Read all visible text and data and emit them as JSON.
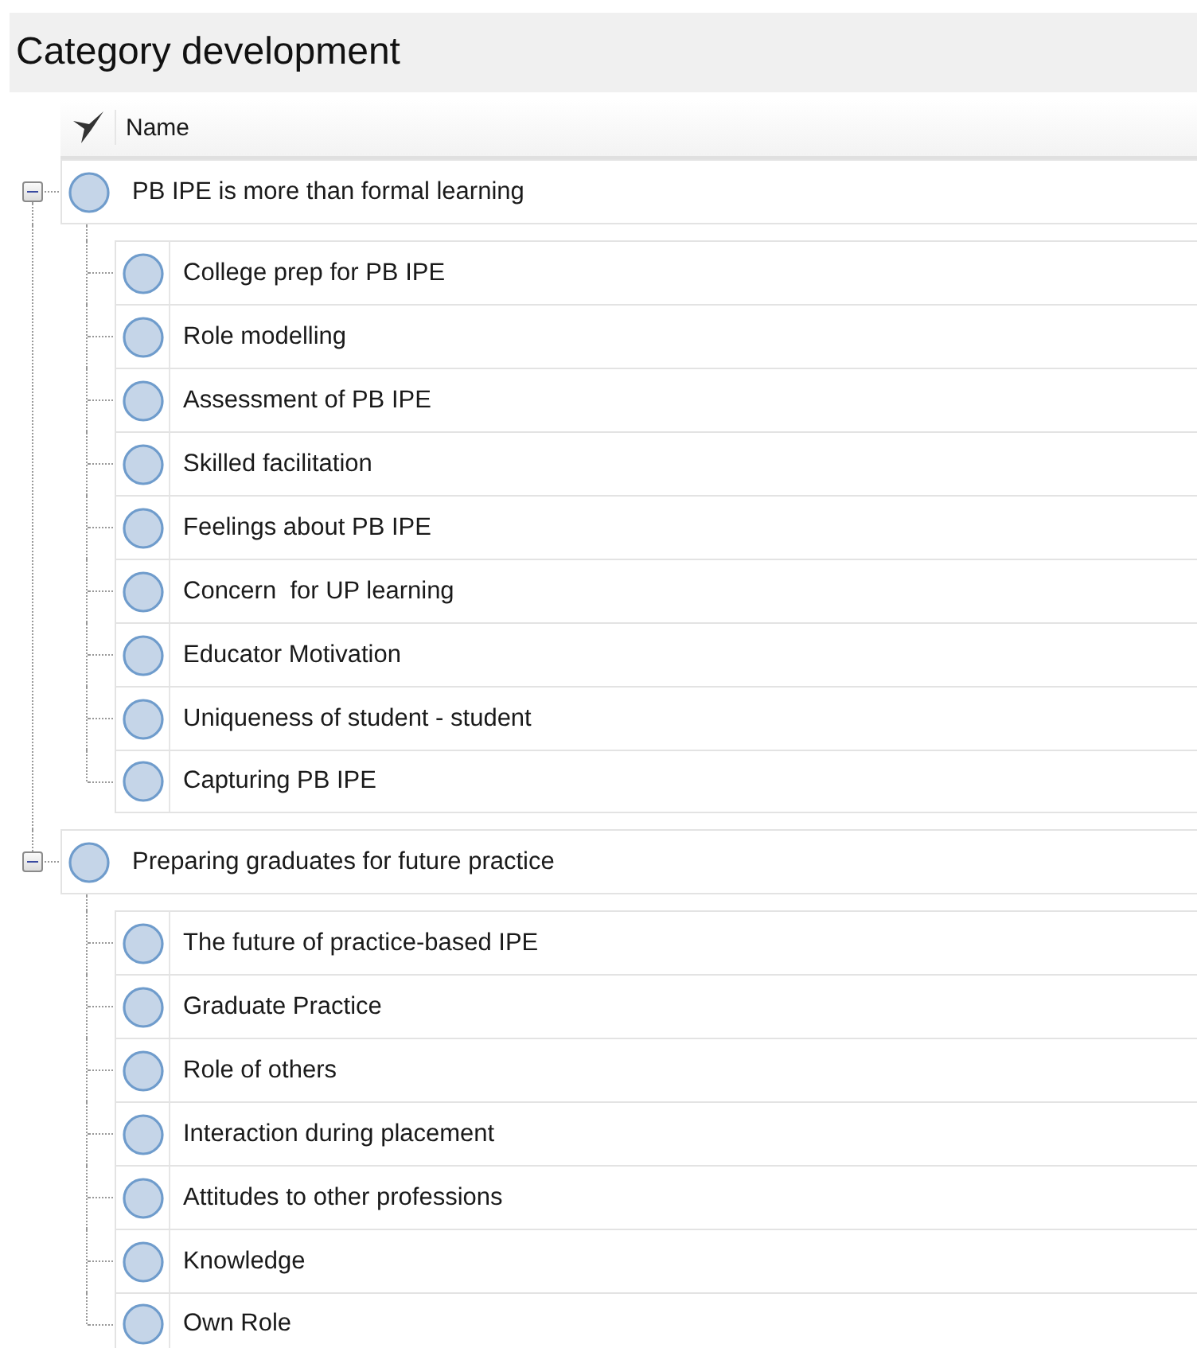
{
  "title": "Category development",
  "column_header": "Name",
  "categories": [
    {
      "name": "PB IPE is more than formal learning",
      "expanded": true,
      "children": [
        {
          "name": "College prep for PB IPE"
        },
        {
          "name": "Role modelling"
        },
        {
          "name": "Assessment of PB IPE"
        },
        {
          "name": "Skilled facilitation"
        },
        {
          "name": "Feelings about PB IPE"
        },
        {
          "name": "Concern  for UP learning"
        },
        {
          "name": "Educator Motivation"
        },
        {
          "name": "Uniqueness of student - student"
        },
        {
          "name": "Capturing PB IPE"
        }
      ]
    },
    {
      "name": "Preparing graduates for future practice",
      "expanded": true,
      "children": [
        {
          "name": "The future of practice-based IPE"
        },
        {
          "name": "Graduate Practice"
        },
        {
          "name": "Role of others"
        },
        {
          "name": "Interaction during placement"
        },
        {
          "name": "Attitudes to other professions"
        },
        {
          "name": "Knowledge"
        },
        {
          "name": "Own Role"
        }
      ]
    }
  ]
}
